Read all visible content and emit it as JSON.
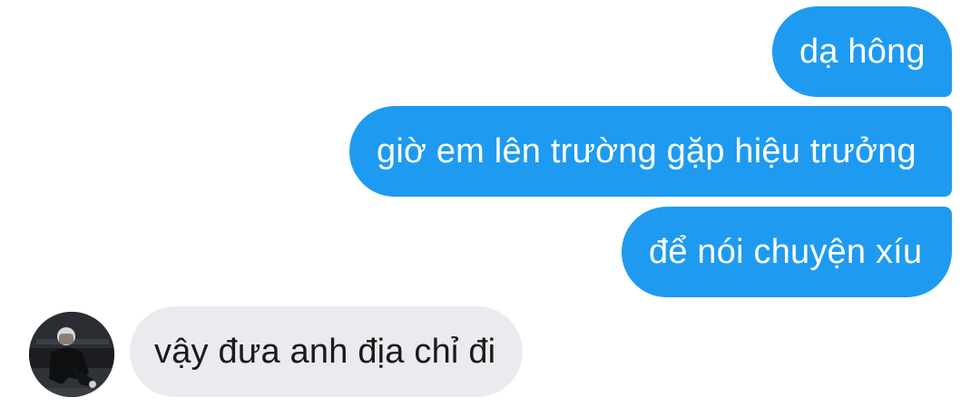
{
  "conversation": {
    "messages": [
      {
        "sender": "me",
        "text": "dạ hông"
      },
      {
        "sender": "me",
        "text": "giờ em lên trường gặp hiệu trưởng"
      },
      {
        "sender": "me",
        "text": "để nói chuyện xíu"
      },
      {
        "sender": "them",
        "text": "vậy đưa anh địa chỉ đi"
      }
    ]
  },
  "colors": {
    "outgoing_bubble": "#1e9bf0",
    "incoming_bubble": "#e9ebee",
    "background": "#ffffff"
  },
  "icons": {
    "contact_avatar": "avatar"
  }
}
